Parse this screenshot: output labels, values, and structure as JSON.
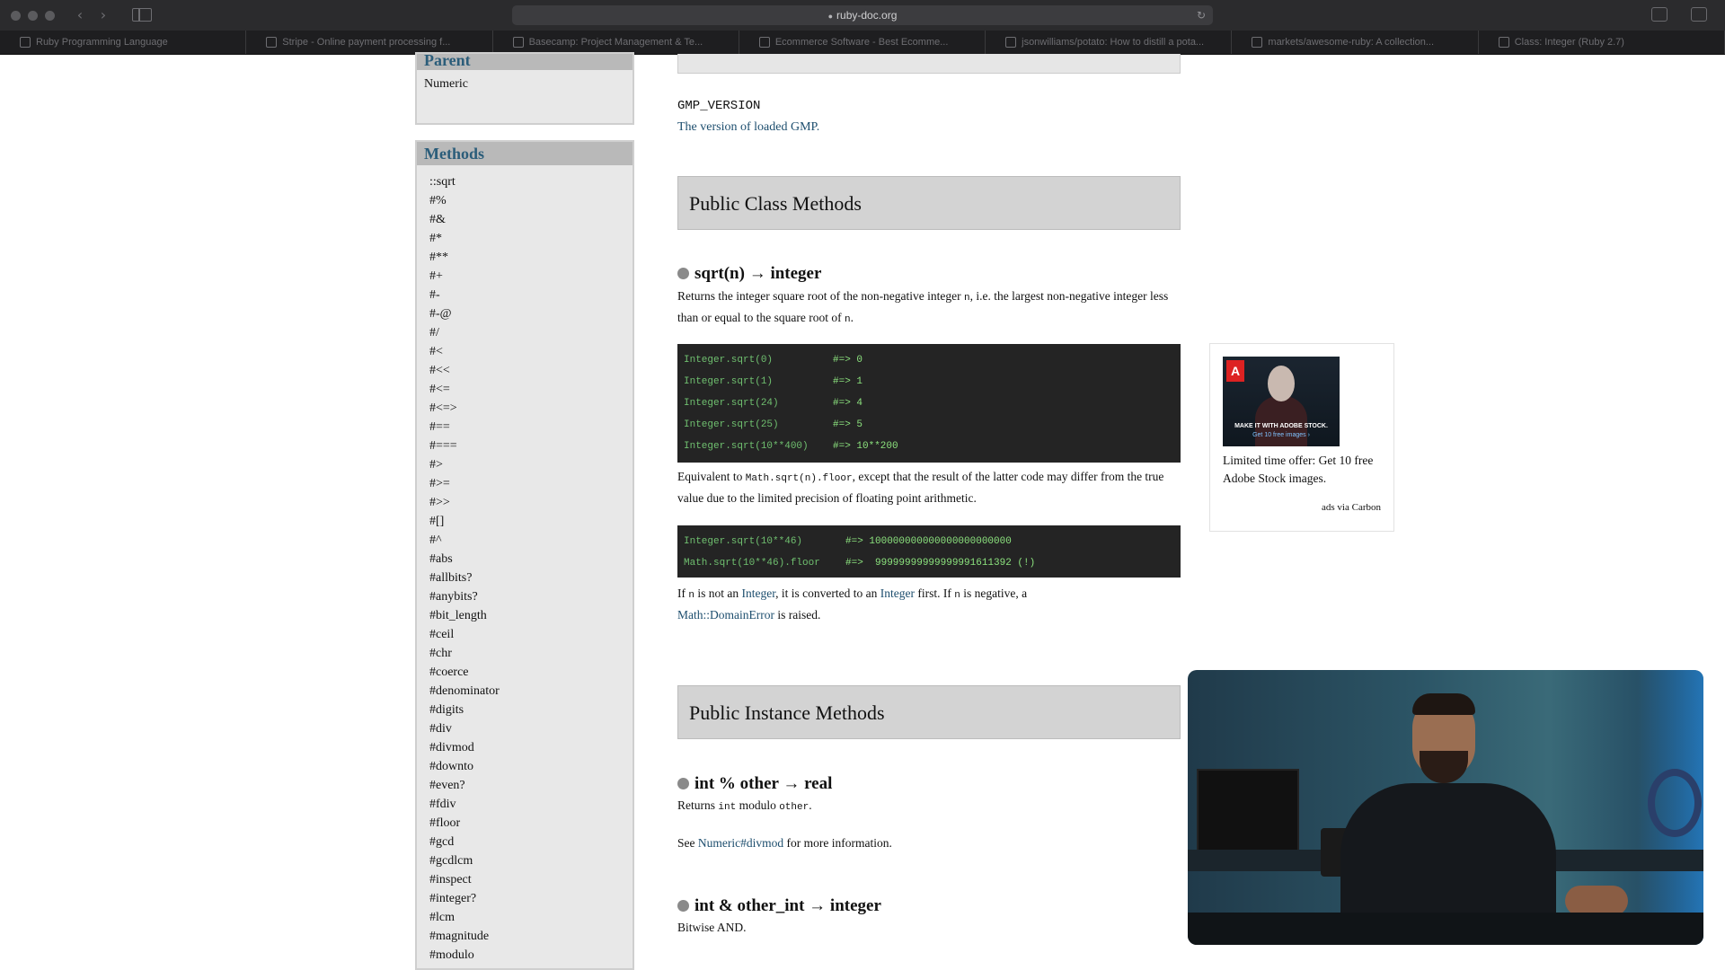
{
  "browser": {
    "url": "ruby-doc.org",
    "tabs": [
      "Ruby Programming Language",
      "Stripe - Online payment processing f...",
      "Basecamp: Project Management & Te...",
      "Ecommerce Software - Best Ecomme...",
      "jsonwilliams/potato: How to distill a pota...",
      "markets/awesome-ruby: A collection...",
      "Class: Integer (Ruby 2.7)"
    ]
  },
  "sidebar": {
    "parent_heading": "Parent",
    "parent_link": "Numeric",
    "methods_heading": "Methods",
    "methods": [
      "::sqrt",
      "#%",
      "#&",
      "#*",
      "#**",
      "#+",
      "#-",
      "#-@",
      "#/",
      "#<",
      "#<<",
      "#<=",
      "#<=>",
      "#==",
      "#===",
      "#>",
      "#>=",
      "#>>",
      "#[]",
      "#^",
      "#abs",
      "#allbits?",
      "#anybits?",
      "#bit_length",
      "#ceil",
      "#chr",
      "#coerce",
      "#denominator",
      "#digits",
      "#div",
      "#divmod",
      "#downto",
      "#even?",
      "#fdiv",
      "#floor",
      "#gcd",
      "#gcdlcm",
      "#inspect",
      "#integer?",
      "#lcm",
      "#magnitude",
      "#modulo"
    ]
  },
  "constant": {
    "name": "GMP_VERSION",
    "description": "The version of loaded GMP."
  },
  "class_methods": {
    "heading": "Public Class Methods",
    "sqrt": {
      "signature": "sqrt(n) → integer",
      "desc_1": "Returns the integer square root of the non-negative integer",
      "desc_n": "n",
      "desc_2": ", i.e. the largest non-negative integer less than or equal to the square root of",
      "desc_n2": "n",
      "desc_3": ".",
      "code1": [
        {
          "expr": "Integer.sqrt(0)",
          "res": "#=> 0"
        },
        {
          "expr": "Integer.sqrt(1)",
          "res": "#=> 1"
        },
        {
          "expr": "Integer.sqrt(24)",
          "res": "#=> 4"
        },
        {
          "expr": "Integer.sqrt(25)",
          "res": "#=> 5"
        },
        {
          "expr": "Integer.sqrt(10**400)",
          "res": "#=> 10**200"
        }
      ],
      "equiv_1": "Equivalent to",
      "equiv_code": "Math.sqrt(n).floor",
      "equiv_2": ", except that the result of the latter code may differ from the true value due to the limited precision of floating point arithmetic.",
      "code2": [
        {
          "expr": "Integer.sqrt(10**46)",
          "res": "#=> 100000000000000000000000"
        },
        {
          "expr": "Math.sqrt(10**46).floor",
          "res": "#=>  99999999999999991611392 (!)"
        }
      ],
      "note_1": "If",
      "note_n": "n",
      "note_2": "is not an",
      "note_link1": "Integer",
      "note_3": ", it is converted to an",
      "note_link2": "Integer",
      "note_4": "first. If",
      "note_n2": "n",
      "note_5": "is negative, a",
      "note_link3": "Math::DomainError",
      "note_6": "is raised."
    }
  },
  "instance_methods": {
    "heading": "Public Instance Methods",
    "mod": {
      "signature": "int % other → real",
      "desc_1": "Returns",
      "desc_int": "int",
      "desc_2": "modulo",
      "desc_other": "other",
      "desc_3": ".",
      "see_1": "See",
      "see_link": "Numeric#divmod",
      "see_2": "for more information."
    },
    "and": {
      "signature": "int & other_int → integer",
      "desc": "Bitwise AND."
    }
  },
  "ad": {
    "image_caption": "MAKE IT WITH ADOBE STOCK.",
    "image_sub": "Get 10 free images ›",
    "logo_letter": "A",
    "text": "Limited time offer: Get 10 free Adobe Stock images.",
    "via": "ads via Carbon"
  }
}
